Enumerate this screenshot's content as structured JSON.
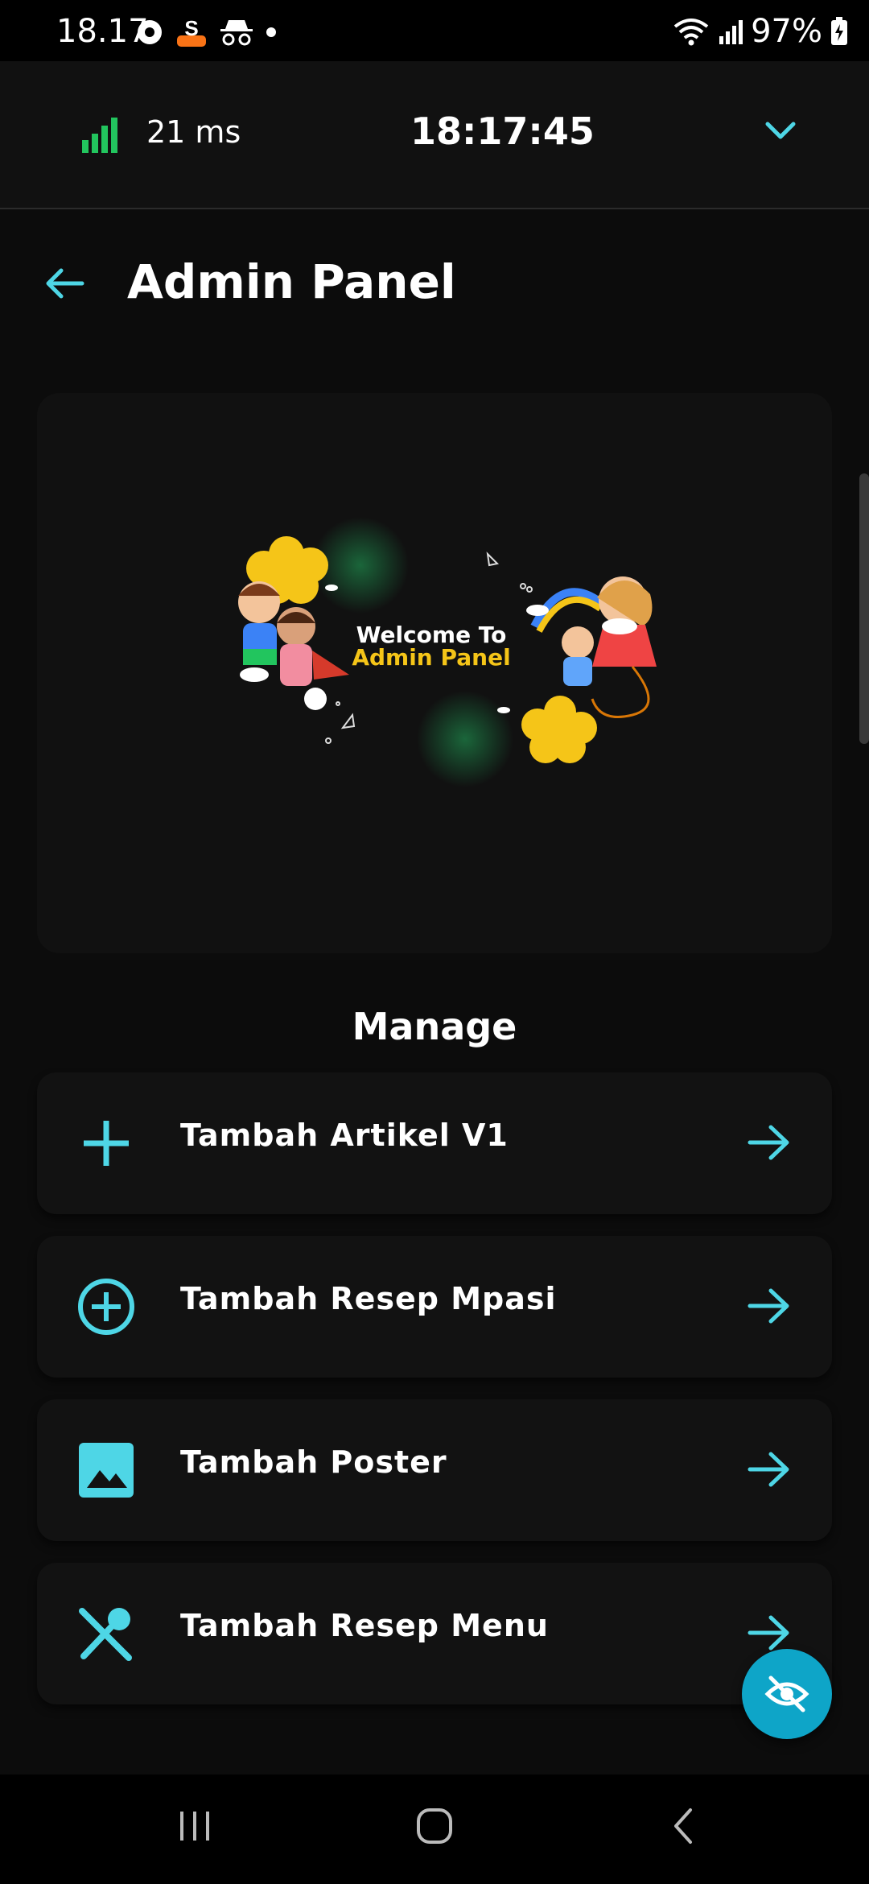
{
  "status_bar": {
    "time": "18.17",
    "battery": "97%",
    "icons": [
      "location-icon",
      "s-app-icon",
      "incognito-icon",
      "dot-icon",
      "wifi-icon",
      "signal-icon",
      "battery-charging-icon"
    ]
  },
  "perf_bar": {
    "latency": "21 ms",
    "clock": "18:17:45"
  },
  "header": {
    "title": "Admin Panel"
  },
  "banner": {
    "line1": "Welcome To",
    "line2": "Admin Panel"
  },
  "section": {
    "title": "Manage"
  },
  "menu": [
    {
      "label": "Tambah Artikel V1",
      "icon": "plus-icon"
    },
    {
      "label": "Tambah Resep Mpasi",
      "icon": "plus-circle-icon"
    },
    {
      "label": "Tambah Poster",
      "icon": "image-icon"
    },
    {
      "label": "Tambah Resep Menu",
      "icon": "utensils-icon"
    }
  ],
  "colors": {
    "accent": "#4ed6e6",
    "fab": "#0ea5c8",
    "signal": "#22c55e",
    "banner_yellow": "#f5c518"
  }
}
